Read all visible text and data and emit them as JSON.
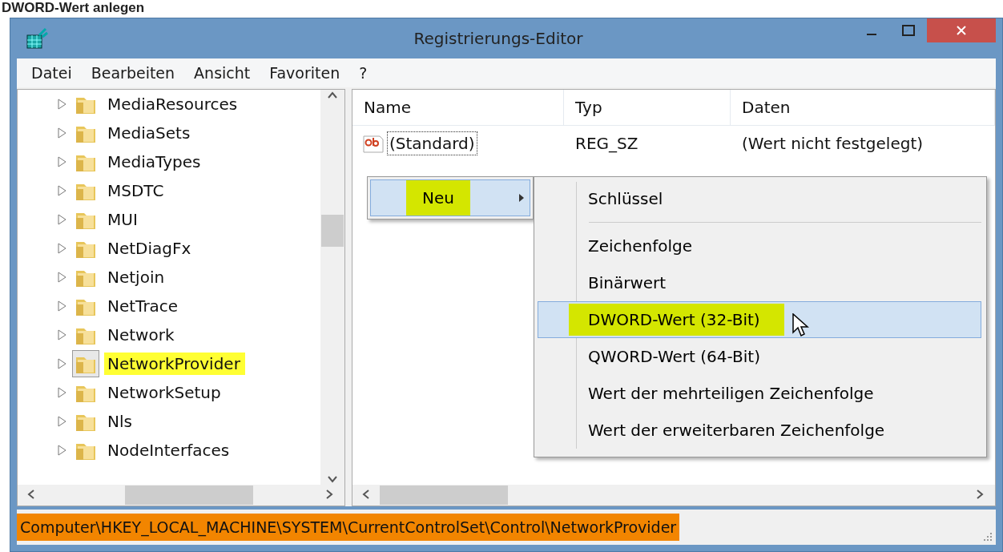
{
  "caption": "DWORD-Wert anlegen",
  "window": {
    "title": "Registrierungs-Editor"
  },
  "menu_bar": [
    "Datei",
    "Bearbeiten",
    "Ansicht",
    "Favoriten",
    "?"
  ],
  "tree": {
    "items": [
      {
        "label": "MediaResources",
        "selected": false,
        "highlighted": false
      },
      {
        "label": "MediaSets",
        "selected": false,
        "highlighted": false
      },
      {
        "label": "MediaTypes",
        "selected": false,
        "highlighted": false
      },
      {
        "label": "MSDTC",
        "selected": false,
        "highlighted": false
      },
      {
        "label": "MUI",
        "selected": false,
        "highlighted": false
      },
      {
        "label": "NetDiagFx",
        "selected": false,
        "highlighted": false
      },
      {
        "label": "Netjoin",
        "selected": false,
        "highlighted": false
      },
      {
        "label": "NetTrace",
        "selected": false,
        "highlighted": false
      },
      {
        "label": "Network",
        "selected": false,
        "highlighted": false
      },
      {
        "label": "NetworkProvider",
        "selected": true,
        "highlighted": true
      },
      {
        "label": "NetworkSetup",
        "selected": false,
        "highlighted": false
      },
      {
        "label": "Nls",
        "selected": false,
        "highlighted": false
      },
      {
        "label": "NodeInterfaces",
        "selected": false,
        "highlighted": false
      }
    ]
  },
  "list": {
    "columns": [
      "Name",
      "Typ",
      "Daten"
    ],
    "rows": [
      {
        "name": "(Standard)",
        "type": "REG_SZ",
        "data": "(Wert nicht festgelegt)",
        "focused": true
      }
    ]
  },
  "context_menu": {
    "items": [
      {
        "label": "Neu",
        "selected": true,
        "highlighted": true
      }
    ]
  },
  "submenu": {
    "items": [
      {
        "label": "Schlüssel",
        "selected": false,
        "highlighted": false,
        "separator_after": true
      },
      {
        "label": "Zeichenfolge",
        "selected": false,
        "highlighted": false,
        "separator_after": false
      },
      {
        "label": "Binärwert",
        "selected": false,
        "highlighted": false,
        "separator_after": false
      },
      {
        "label": "DWORD-Wert (32-Bit)",
        "selected": true,
        "highlighted": true,
        "separator_after": false
      },
      {
        "label": "QWORD-Wert (64-Bit)",
        "selected": false,
        "highlighted": false,
        "separator_after": false
      },
      {
        "label": "Wert der mehrteiligen Zeichenfolge",
        "selected": false,
        "highlighted": false,
        "separator_after": false
      },
      {
        "label": "Wert der erweiterbaren Zeichenfolge",
        "selected": false,
        "highlighted": false,
        "separator_after": false
      }
    ]
  },
  "status_bar": {
    "path": "Computer\\HKEY_LOCAL_MACHINE\\SYSTEM\\CurrentControlSet\\Control\\NetworkProvider",
    "highlighted": true
  }
}
